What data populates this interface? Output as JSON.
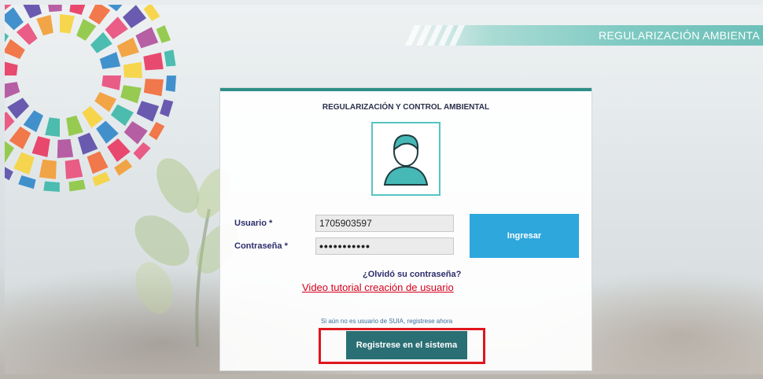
{
  "header": {
    "brand": "REGULARIZACIÓN AMBIENTA"
  },
  "login": {
    "title": "REGULARIZACIÓN Y CONTROL AMBIENTAL",
    "user_label": "Usuario *",
    "user_value": "1705903597",
    "password_label": "Contraseña *",
    "password_value": "•••••••••••",
    "submit_label": "Ingresar",
    "forgot_link": "¿Olvidó su contraseña?",
    "video_link": "Video tutorial creación de usuario",
    "register_hint": "Si aún no es usuario de SUIA, registrese ahora",
    "register_button": "Registrese en el sistema"
  },
  "colors": {
    "accent": "#2f8f88",
    "primary_button": "#2ea7dc",
    "register_button": "#2a6f74",
    "highlight": "#e0161d",
    "link": "#d6001c"
  },
  "icons": [
    "user-avatar-icon"
  ]
}
